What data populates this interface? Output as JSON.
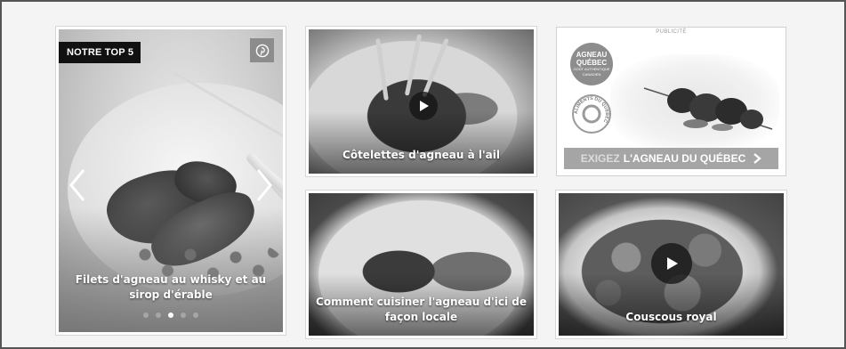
{
  "featured": {
    "badge": "NOTRE TOP 5",
    "title": "Filets d'agneau au whisky et au sirop d'érable",
    "slides_total": 5,
    "active_slide": 3,
    "pin_icon": "pinterest-icon",
    "prev_icon": "chevron-left-icon",
    "next_icon": "chevron-right-icon"
  },
  "recipes": [
    {
      "title": "Côtelettes d'agneau à l'ail",
      "has_video": true
    },
    {
      "title": "Comment cuisiner l'agneau d'ici de façon locale",
      "has_video": false
    },
    {
      "title": "Couscous royal",
      "has_video": true
    }
  ],
  "ad": {
    "label": "PUBLICITÉ",
    "logo_line1": "AGNEAU",
    "logo_line2": "QUÉBEC",
    "logo_tagline": "GOÛT AUTHENTIQUE CANADIEN",
    "seal_text": "ALIMENTS DU QUÉBEC",
    "cta_prefix": "EXIGEZ",
    "cta_brand": "L'AGNEAU DU QUÉBEC"
  }
}
